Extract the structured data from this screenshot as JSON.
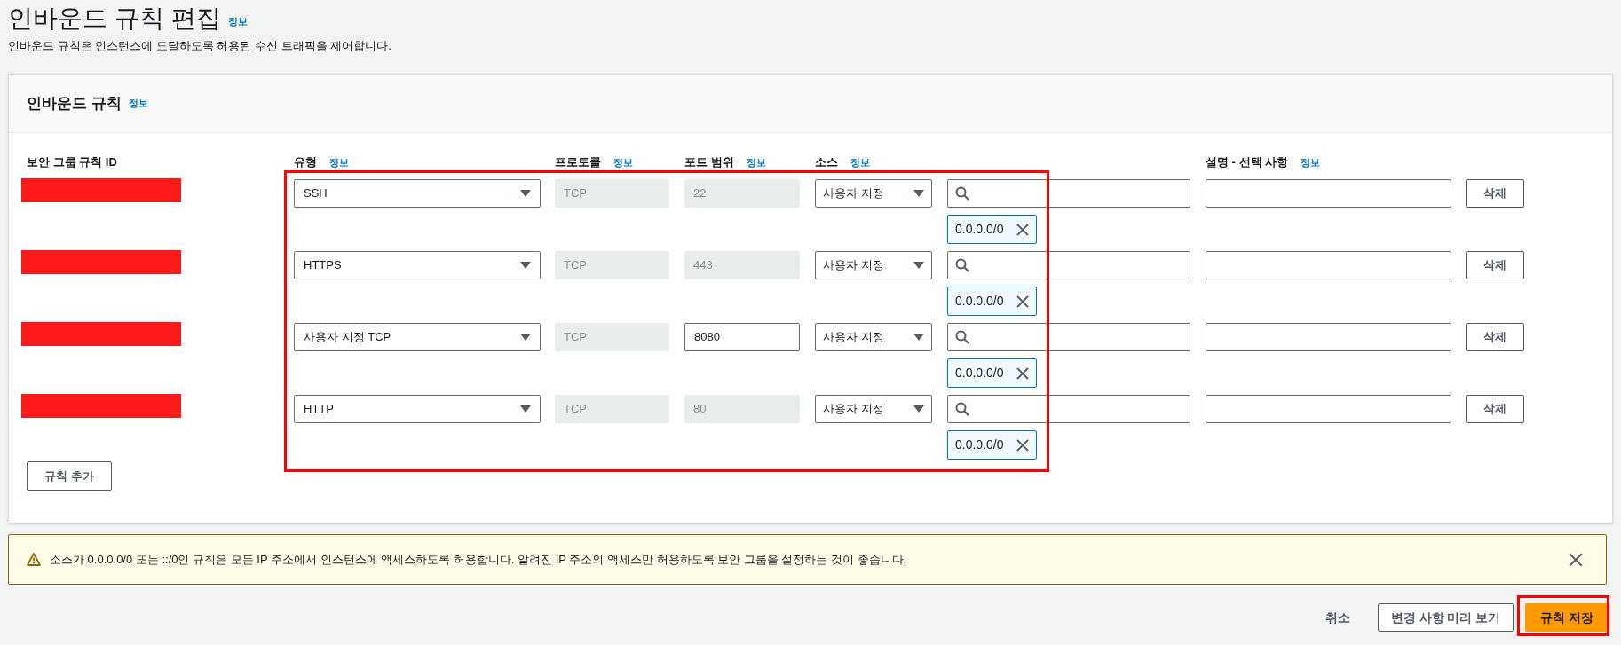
{
  "page": {
    "title": "인바운드 규칙 편집",
    "info_link": "정보",
    "description": "인바운드 규칙은 인스턴스에 도달하도록 허용된 수신 트래픽을 제어합니다."
  },
  "panel": {
    "title": "인바운드 규칙",
    "info_link": "정보",
    "columns": [
      {
        "label": "보안 그룹 규칙 ID"
      },
      {
        "label": "유형",
        "info_link": "정보"
      },
      {
        "label": "프로토콜",
        "info_link": "정보"
      },
      {
        "label": "포트 범위",
        "info_link": "정보"
      },
      {
        "label": "소스",
        "info_link": "정보"
      },
      {
        "label": "설명 - 선택 사항",
        "info_link": "정보"
      }
    ],
    "rows": [
      {
        "type": "SSH",
        "protocol": "TCP",
        "port": "22",
        "port_disabled": true,
        "source": "사용자 지정",
        "cidr": "0.0.0.0/0",
        "delete": "삭제"
      },
      {
        "type": "HTTPS",
        "protocol": "TCP",
        "port": "443",
        "port_disabled": true,
        "source": "사용자 지정",
        "cidr": "0.0.0.0/0",
        "delete": "삭제"
      },
      {
        "type": "사용자 지정 TCP",
        "protocol": "TCP",
        "port": "8080",
        "port_disabled": false,
        "source": "사용자 지정",
        "cidr": "0.0.0.0/0",
        "delete": "삭제"
      },
      {
        "type": "HTTP",
        "protocol": "TCP",
        "port": "80",
        "port_disabled": true,
        "source": "사용자 지정",
        "cidr": "0.0.0.0/0",
        "delete": "삭제"
      }
    ],
    "add_button": "규칙 추가"
  },
  "warning": {
    "text": "소스가 0.0.0.0/0 또는 ::/0인 규칙은 모든 IP 주소에서 인스턴스에 액세스하도록 허용합니다. 알려진 IP 주소의 액세스만 허용하도록 보안 그룹을 설정하는 것이 좋습니다."
  },
  "footer": {
    "cancel": "취소",
    "preview": "변경 사항 미리 보기",
    "save": "규칙 저장"
  }
}
